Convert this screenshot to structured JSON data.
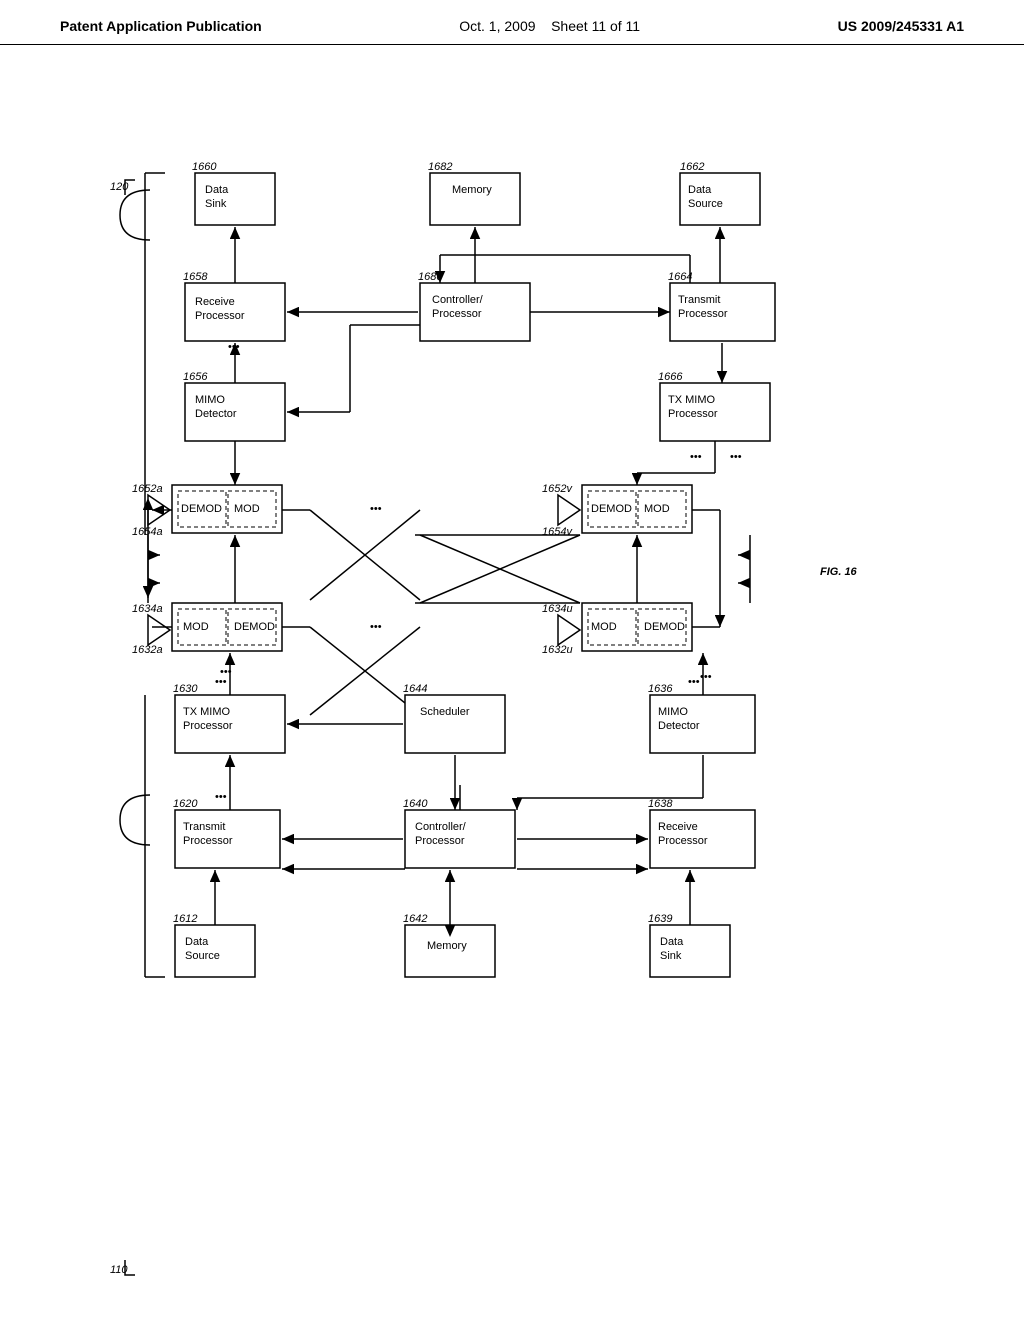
{
  "header": {
    "left": "Patent Application Publication",
    "center_date": "Oct. 1, 2009",
    "center_sheet": "Sheet 11 of 11",
    "right": "US 2009/245331 A1"
  },
  "diagram": {
    "fig_label": "FIG. 16",
    "top_section_label": "120",
    "bottom_section_label": "110",
    "boxes": {
      "data_sink_top": {
        "id": "1660",
        "label": "Data\nSink"
      },
      "memory_top": {
        "id": "1682",
        "label": "Memory"
      },
      "data_source_top": {
        "id": "1662",
        "label": "Data\nSource"
      },
      "receive_proc_top": {
        "id": "1658",
        "label": "Receive\nProcessor"
      },
      "controller_top": {
        "id": "1680",
        "label": "Controller/\nProcessor"
      },
      "transmit_proc_top": {
        "id": "1664",
        "label": "Transmit\nProcessor"
      },
      "mimo_detector_top": {
        "id": "1656",
        "label": "MIMO\nDetector"
      },
      "tx_mimo_top": {
        "id": "1666",
        "label": "TX MIMO\nProcessor"
      },
      "demod_mod_top_a": {
        "id": "1654a",
        "outer": "1652a",
        "label": "DEMOD\nMOD"
      },
      "demod_mod_top_v": {
        "id": "1654v",
        "outer": "1652v",
        "label": "DEMOD\nMOD"
      },
      "mod_demod_bot_a": {
        "id": "1632a",
        "outer": "1634a",
        "label": "MOD\nDEMOD"
      },
      "mod_demod_bot_u": {
        "id": "1632u",
        "outer": "1634u",
        "label": "MOD\nDEMOD"
      },
      "tx_mimo_bot": {
        "id": "1630",
        "label": "TX MIMO\nProcessor"
      },
      "scheduler": {
        "id": "1644",
        "label": "Scheduler"
      },
      "mimo_detector_bot": {
        "id": "1636",
        "label": "MIMO\nDetector"
      },
      "transmit_proc_bot": {
        "id": "1620",
        "label": "Transmit\nProcessor"
      },
      "controller_bot": {
        "id": "1640",
        "label": "Controller/\nProcessor"
      },
      "receive_proc_bot": {
        "id": "1638",
        "label": "Receive\nProcessor"
      },
      "data_source_bot": {
        "id": "1612",
        "label": "Data\nSource"
      },
      "memory_bot": {
        "id": "1642",
        "label": "Memory"
      },
      "data_sink_bot": {
        "id": "1639",
        "label": "Data\nSink"
      }
    }
  }
}
